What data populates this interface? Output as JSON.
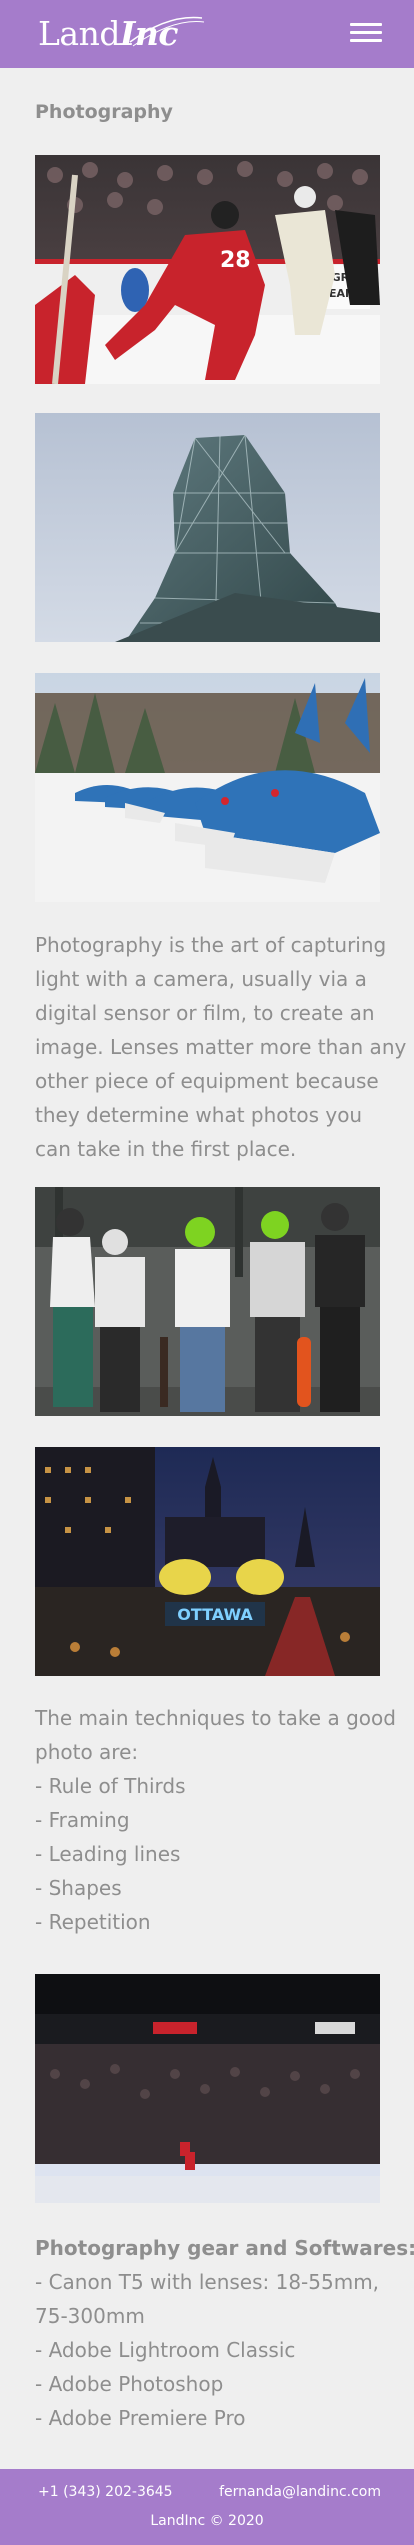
{
  "header": {
    "logo_land": "Land",
    "logo_inc": "Inc",
    "menu_icon": "hamburger-menu-icon",
    "color": "#a57ccb"
  },
  "page": {
    "title": "Photography"
  },
  "photos": [
    {
      "name": "hockey-game-photo",
      "alt": "Hockey players on ice"
    },
    {
      "name": "glass-building-photo",
      "alt": "Glass tower of a building against sky"
    },
    {
      "name": "dragon-boats-photo",
      "alt": "Dragon boat heads lined up on snow"
    },
    {
      "name": "skateboarders-photo",
      "alt": "Group of skateboarders wearing helmets"
    },
    {
      "name": "ottawa-night-photo",
      "alt": "Ottawa sign at night with city lights"
    },
    {
      "name": "arena-photo",
      "alt": "Hockey arena with crowd"
    }
  ],
  "intro": {
    "lines": [
      "Photography is the art of capturing",
      "light with a camera, usually via a",
      "digital sensor or film, to create an",
      "image. Lenses matter more than any",
      "other piece of equipment because",
      "they determine what photos you",
      "can take in the first place."
    ]
  },
  "techniques": {
    "lines": [
      "The main techniques to take a good",
      "photo are:",
      "- Rule of Thirds",
      "- Framing",
      "- Leading lines",
      "- Shapes",
      "- Repetition"
    ]
  },
  "gear": {
    "title": "Photography gear and Softwares:",
    "lines": [
      "- Canon T5 with lenses: 18-55mm,",
      "75-300mm",
      "- Adobe Lightroom Classic",
      "- Adobe Photoshop",
      "- Adobe Premiere Pro"
    ]
  },
  "photo_text": {
    "ottawa": "OTTAWA"
  },
  "footer": {
    "phone": "+1 (343) 202-3645",
    "email": "fernanda@landinc.com",
    "copyright": "LandInc © 2020"
  }
}
